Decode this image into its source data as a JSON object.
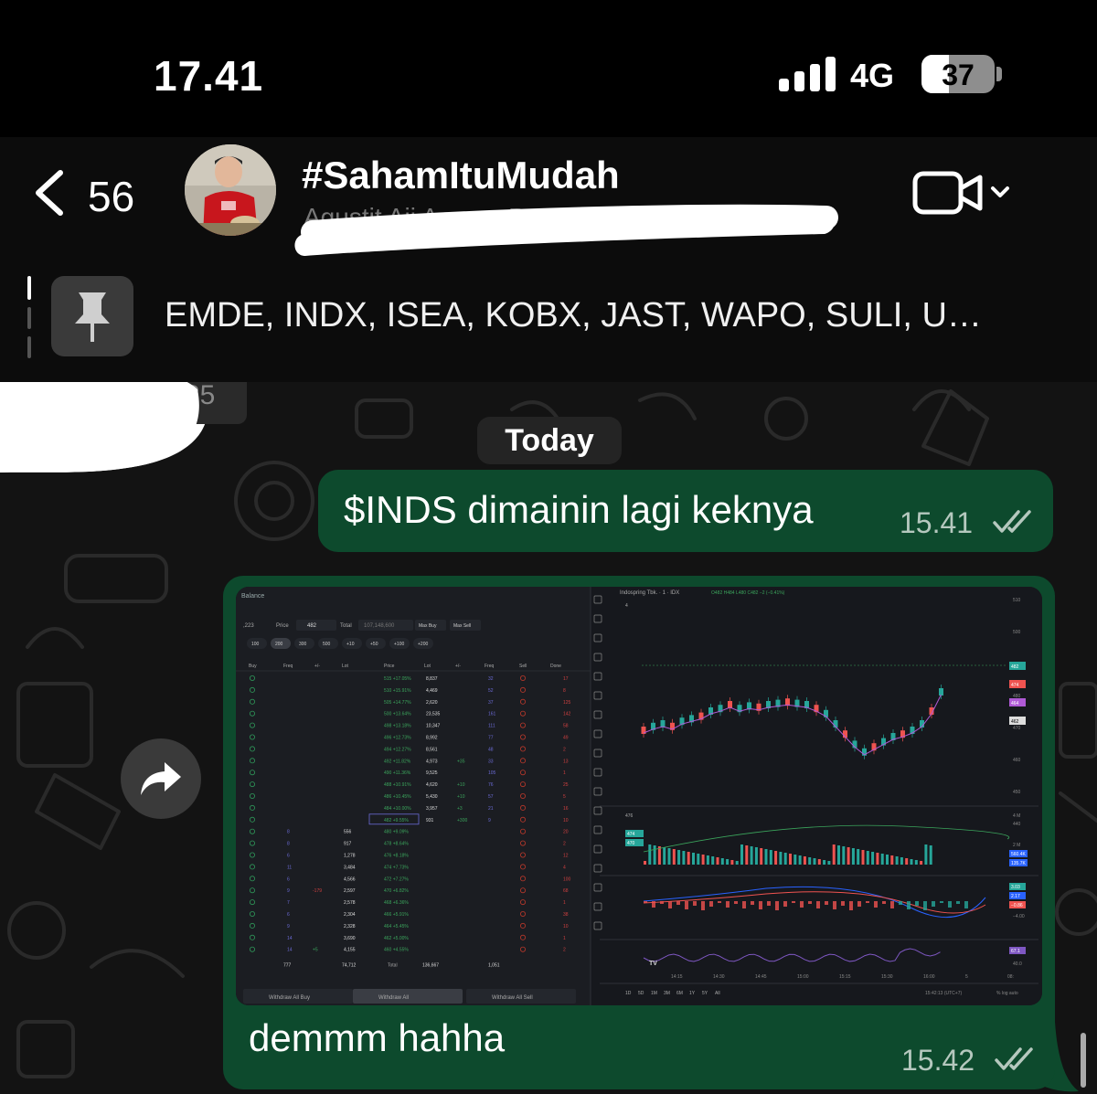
{
  "status_bar": {
    "time": "17.41",
    "network": "4G",
    "battery": "37",
    "battery_level": 0.37
  },
  "header": {
    "back_count": "56",
    "title": "#SahamItuMudah",
    "subtitle": "Agustit Aji Aazam Boogy Fi…"
  },
  "pinned": {
    "text": "EMDE, INDX, ISEA, KOBX, JAST, WAPO, SULI, U…",
    "count_partial": "25"
  },
  "date_chip": "Today",
  "messages": [
    {
      "text": "$INDS dimainin lagi keknya",
      "time": "15.41"
    },
    {
      "text": "demmm hahha",
      "time": "15.42"
    }
  ],
  "screenshot": {
    "panel_title": "Balance",
    "order": {
      "qty": ",223",
      "price_label": "Price",
      "price": "482",
      "total_label": "Total",
      "total": "107,148,600",
      "max_buy": "Max Buy",
      "max_sell": "Max Sell"
    },
    "lot_presets": [
      "100",
      "200",
      "300",
      "500",
      "+10",
      "+50",
      "+100",
      "+200"
    ],
    "columns": [
      "Buy",
      "Freq",
      "+/-",
      "Lot",
      "Price",
      "Lot",
      "+/-",
      "Freq",
      "Sell",
      "Done"
    ],
    "ask_rows": [
      [
        "",
        "",
        "",
        "",
        "515 +17.05%",
        "8,837",
        "",
        "32",
        "",
        "17"
      ],
      [
        "",
        "",
        "",
        "",
        "510 +15.91%",
        "4,469",
        "",
        "52",
        "",
        "8"
      ],
      [
        "",
        "",
        "",
        "",
        "505 +14.77%",
        "2,620",
        "",
        "37",
        "",
        "125"
      ],
      [
        "",
        "",
        "",
        "",
        "500 +13.64%",
        "23,535",
        "",
        "161",
        "",
        "142"
      ],
      [
        "",
        "",
        "",
        "",
        "498 +13.18%",
        "10,347",
        "",
        "111",
        "",
        "58"
      ],
      [
        "",
        "",
        "",
        "",
        "496 +12.73%",
        "8,992",
        "",
        "77",
        "",
        "49"
      ],
      [
        "",
        "",
        "",
        "",
        "494 +12.27%",
        "8,561",
        "",
        "48",
        "",
        "2"
      ],
      [
        "",
        "",
        "",
        "",
        "492 +11.82%",
        "4,973",
        "+35",
        "33",
        "",
        "13"
      ],
      [
        "",
        "",
        "",
        "",
        "490 +11.36%",
        "9,525",
        "",
        "105",
        "",
        "1"
      ],
      [
        "",
        "",
        "",
        "",
        "488 +10.91%",
        "4,620",
        "+10",
        "76",
        "",
        "25"
      ],
      [
        "",
        "",
        "",
        "",
        "486 +10.45%",
        "5,430",
        "+10",
        "57",
        "",
        "5"
      ],
      [
        "",
        "",
        "",
        "",
        "484 +10.00%",
        "3,957",
        "+3",
        "21",
        "",
        "16"
      ],
      [
        "",
        "",
        "",
        "",
        "482 +9.55%",
        "931",
        "+300",
        "9",
        "",
        "10"
      ]
    ],
    "bid_rows": [
      [
        "",
        "8",
        "",
        "556",
        "480 +9.09%",
        "",
        "",
        "",
        "",
        "20"
      ],
      [
        "",
        "8",
        "",
        "917",
        "478 +8.64%",
        "",
        "",
        "",
        "",
        "2"
      ],
      [
        "",
        "6",
        "",
        "1,278",
        "476 +8.18%",
        "",
        "",
        "",
        "",
        "12"
      ],
      [
        "",
        "11",
        "",
        "3,484",
        "474 +7.73%",
        "",
        "",
        "",
        "",
        "4"
      ],
      [
        "",
        "6",
        "",
        "4,566",
        "472 +7.27%",
        "",
        "",
        "",
        "",
        "100"
      ],
      [
        "",
        "9",
        "-179",
        "2,597",
        "470 +6.82%",
        "",
        "",
        "",
        "",
        "68"
      ],
      [
        "",
        "7",
        "",
        "2,578",
        "468 +6.36%",
        "",
        "",
        "",
        "",
        "1"
      ],
      [
        "",
        "6",
        "",
        "2,304",
        "466 +5.91%",
        "",
        "",
        "",
        "",
        "38"
      ],
      [
        "",
        "9",
        "",
        "2,328",
        "464 +5.45%",
        "",
        "",
        "",
        "",
        "10"
      ],
      [
        "",
        "14",
        "",
        "3,690",
        "462 +5.00%",
        "",
        "",
        "",
        "",
        "1"
      ],
      [
        "",
        "14",
        "+5",
        "4,155",
        "460 +4.55%",
        "",
        "",
        "",
        "",
        "2"
      ]
    ],
    "totals": {
      "freq": "777",
      "lot": "74,712",
      "label": "Total",
      "lot2": "136,667",
      "freq2": "1,051"
    },
    "buttons": [
      "Withdraw All Buy",
      "Withdraw All",
      "Withdraw All Sell"
    ],
    "chart_header": "Indospring Tbk. · 1 · IDX",
    "ohlc": "O482 H484 L480 C482 −2 (−0.41%)",
    "indicator_count": "4",
    "price_axis": [
      "510",
      "500",
      "490",
      "480",
      "470",
      "460",
      "450",
      "440",
      "430"
    ],
    "price_tags": [
      "482",
      "474",
      "464",
      "462"
    ],
    "volume_axis": [
      "4 M",
      "2 M"
    ],
    "volume_label": "476",
    "volume_tags": [
      "474",
      "470",
      "560.4K",
      "135.7K"
    ],
    "macd_tags": [
      "3.03",
      "2.17",
      "−0.86"
    ],
    "macd_axis": [
      "−4.00"
    ],
    "rsi_tags": [
      "67.1"
    ],
    "rsi_axis": [
      "40.0"
    ],
    "time_axis": [
      "14:15",
      "14:30",
      "14:45",
      "15:00",
      "15:15",
      "15:30",
      "16:00",
      "5",
      "08:"
    ],
    "ranges": [
      "1D",
      "5D",
      "1M",
      "3M",
      "6M",
      "1Y",
      "5Y",
      "All"
    ],
    "clock": "15:42:13 (UTC+7)",
    "options": "%  log  auto"
  }
}
